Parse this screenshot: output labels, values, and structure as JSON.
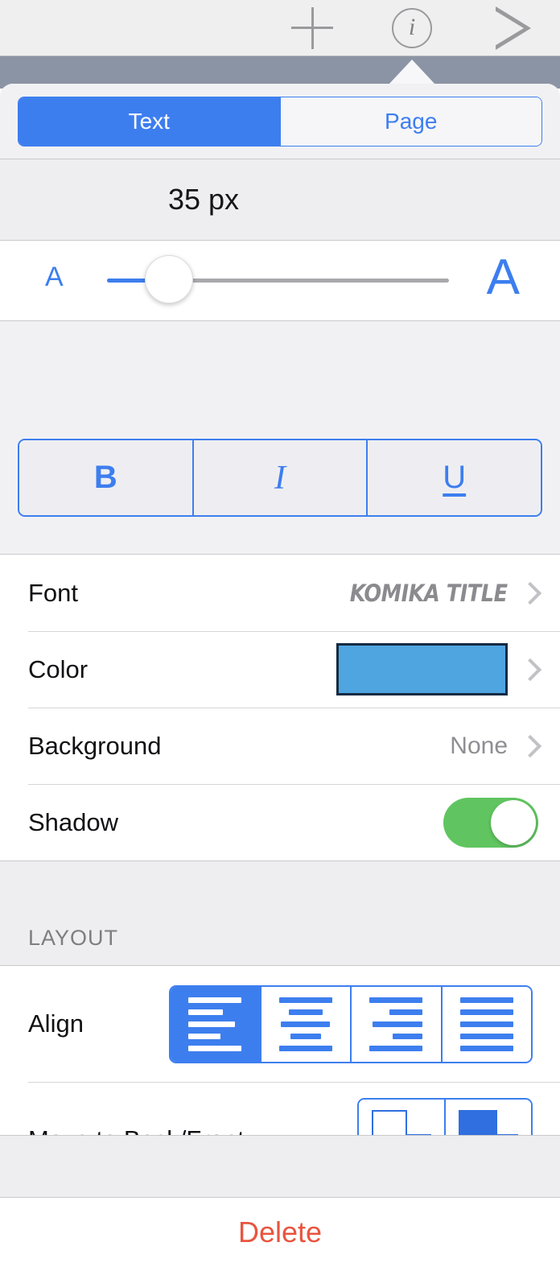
{
  "toolbar": {
    "add_icon": "plus-icon",
    "info_icon": "info-circle-icon",
    "info_glyph": "i",
    "play_icon": "play-triangle-icon"
  },
  "popover": {
    "tabs": {
      "items": [
        {
          "label": "Text",
          "selected": true
        },
        {
          "label": "Page",
          "selected": false
        }
      ]
    },
    "font_size": {
      "value_label": "35 px",
      "min_icon_label": "A",
      "max_icon_label": "A",
      "slider_percent": 18
    },
    "style_buttons": [
      {
        "label": "B",
        "name": "bold"
      },
      {
        "label": "I",
        "name": "italic"
      },
      {
        "label": "U",
        "name": "underline"
      }
    ],
    "rows": [
      {
        "label": "Font",
        "value": "KOMIKA TITLE",
        "type": "chevron"
      },
      {
        "label": "Color",
        "value": "",
        "type": "swatch",
        "swatch_color": "#4fa5e0"
      },
      {
        "label": "Background",
        "value": "None",
        "type": "chevron"
      },
      {
        "label": "Shadow",
        "value": "",
        "type": "toggle",
        "toggle_on": true,
        "toggle_color": "#60c560"
      }
    ],
    "layout_section": {
      "title": "LAYOUT",
      "align_row_label": "Align",
      "align_options": [
        {
          "name": "align-left",
          "selected": true
        },
        {
          "name": "align-center",
          "selected": false
        },
        {
          "name": "align-right",
          "selected": false
        },
        {
          "name": "align-justify",
          "selected": false
        }
      ],
      "layer_row_label": "Move to Back/Front",
      "layer_options": [
        {
          "name": "move-to-back"
        },
        {
          "name": "move-to-front"
        }
      ]
    },
    "delete_label": "Delete"
  },
  "colors": {
    "accent_blue": "#3d7eef",
    "toggle_green": "#60c560",
    "delete_red": "#e8553f",
    "swatch_blue": "#4fa5e0"
  }
}
